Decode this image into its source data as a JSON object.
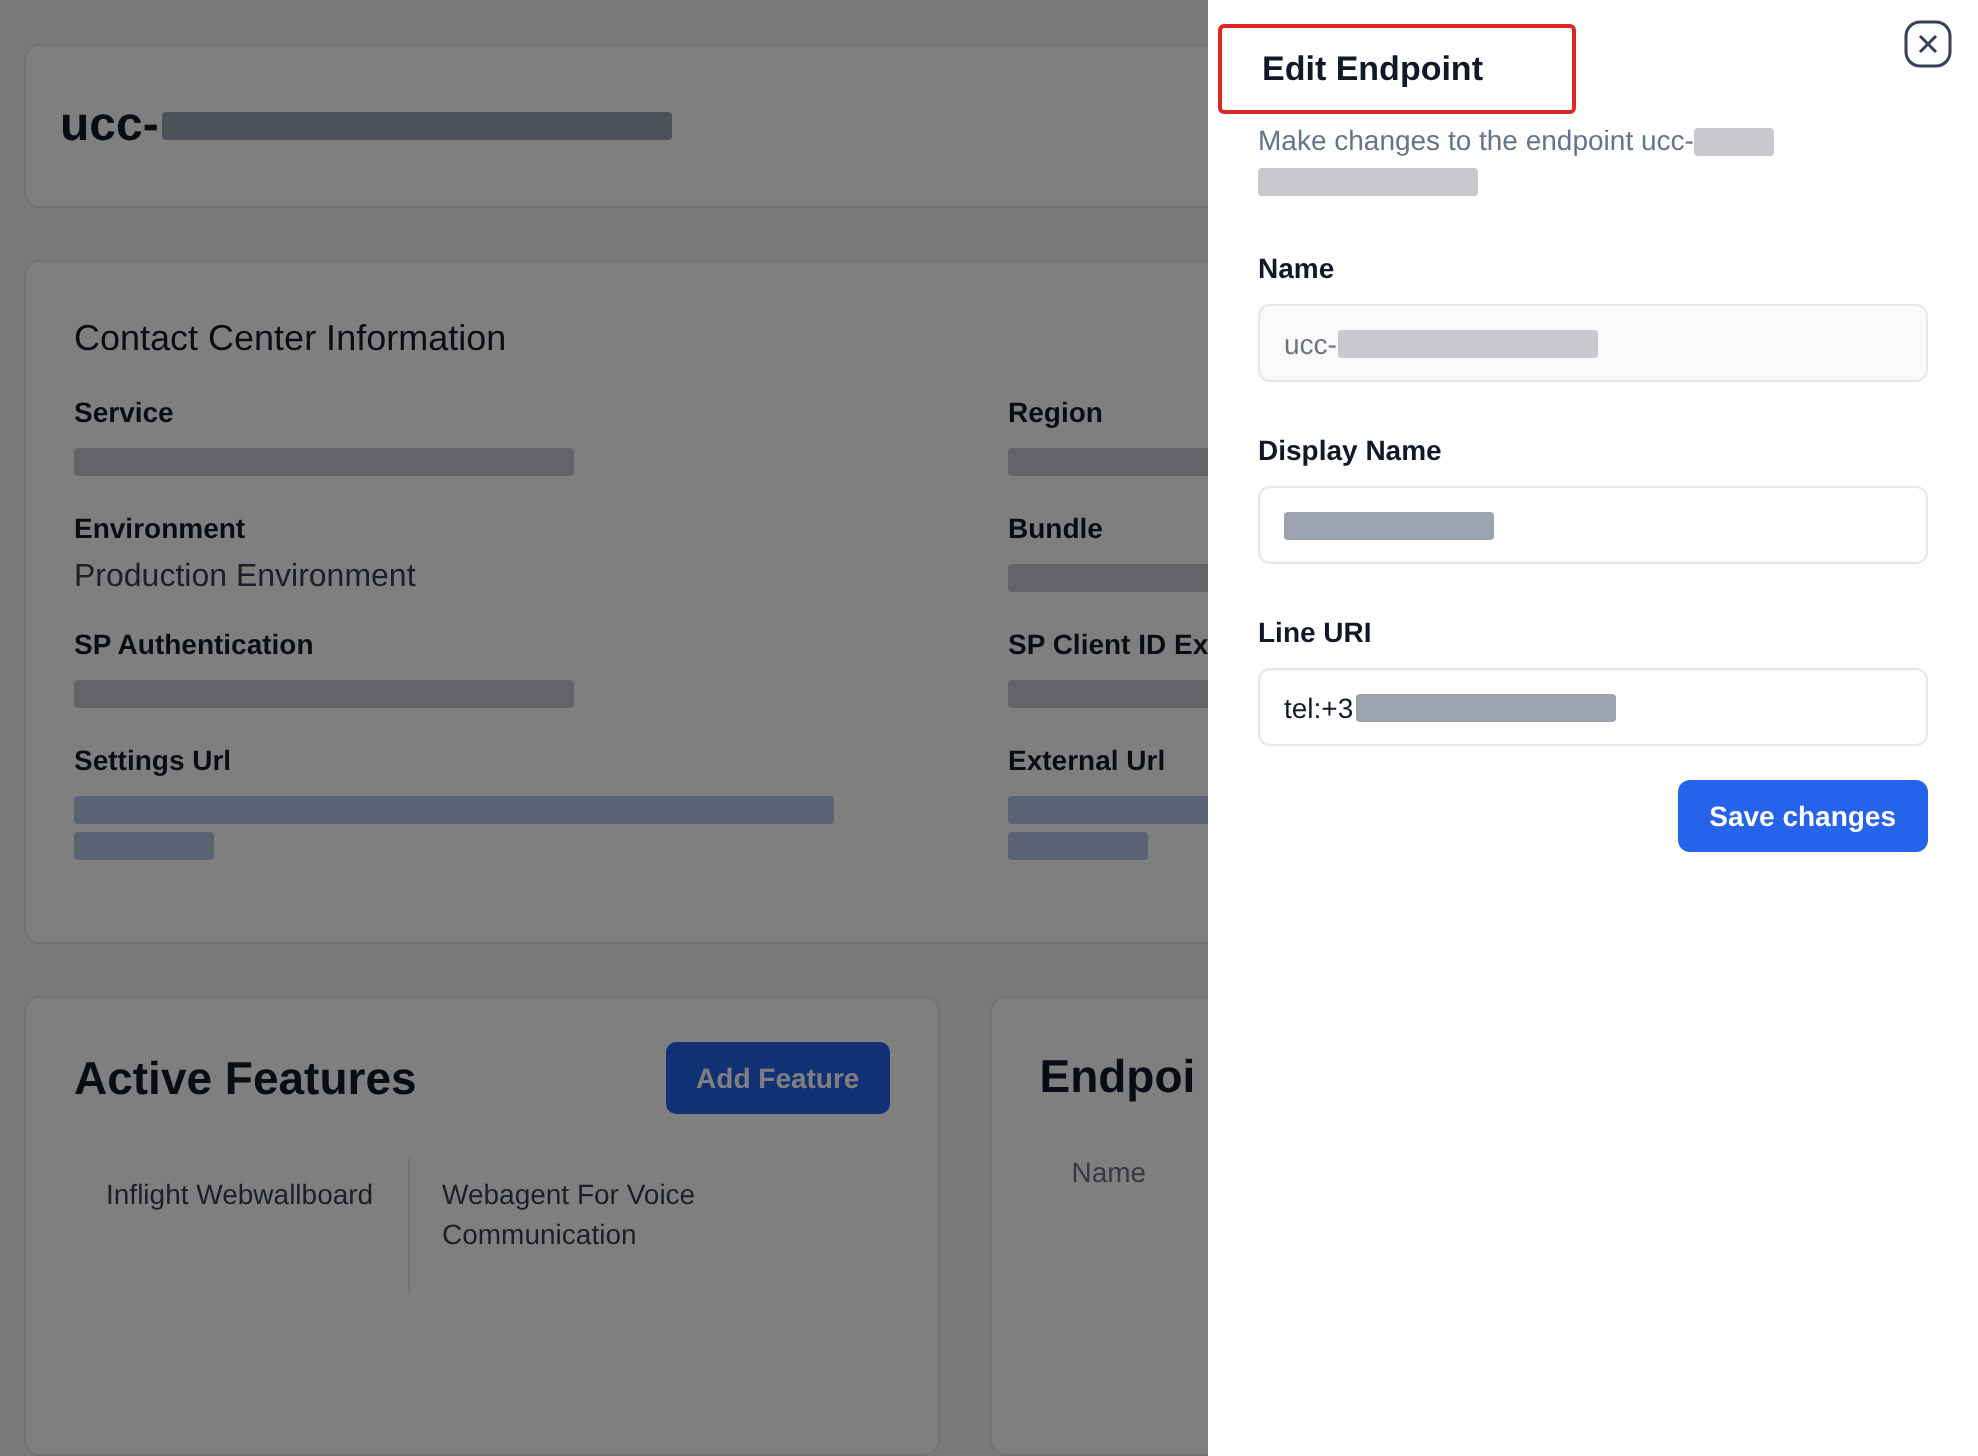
{
  "page": {
    "title": "ucc-",
    "info_card": {
      "title": "Contact Center Information",
      "fields": [
        {
          "label": "Service"
        },
        {
          "label": "Region"
        },
        {
          "label": "Environment",
          "value": "Production Environment"
        },
        {
          "label": "Bundle"
        },
        {
          "label": "SP Authentication"
        },
        {
          "label": "SP Client ID Ex"
        },
        {
          "label": "Settings Url"
        },
        {
          "label": "External Url"
        }
      ]
    },
    "features_card": {
      "title": "Active Features",
      "button": "Add Feature",
      "features": [
        "Inflight Webwallboard",
        "Webagent For Voice Communication"
      ]
    },
    "endpoints_card": {
      "title": "Endpoi",
      "columns": [
        "Name"
      ]
    }
  },
  "drawer": {
    "title": "Edit Endpoint",
    "highlighted": true,
    "description": "Make changes to the endpoint ucc-",
    "fields": [
      {
        "label": "Name",
        "value": "ucc-",
        "disabled": true
      },
      {
        "label": "Display Name",
        "disabled": false
      },
      {
        "label": "Line URI",
        "value": "tel:+3",
        "disabled": false
      }
    ],
    "button": "Save changes"
  }
}
